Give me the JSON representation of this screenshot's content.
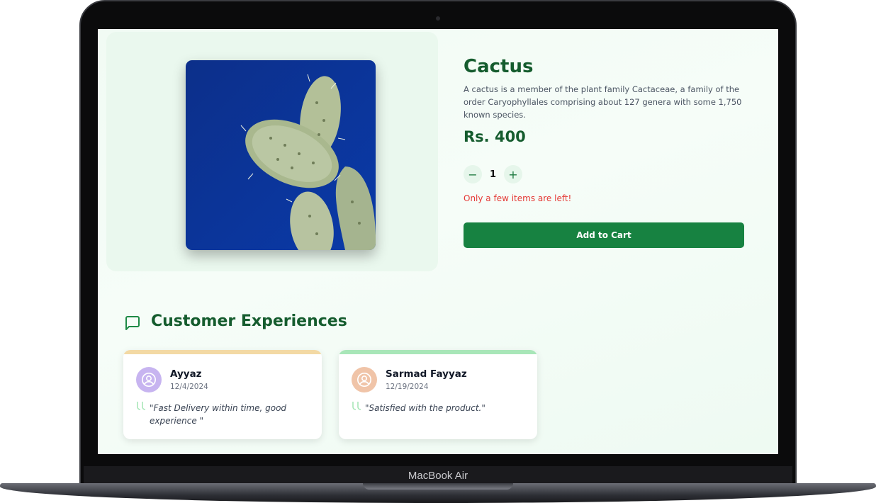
{
  "device": {
    "label": "MacBook Air"
  },
  "product": {
    "name": "Cactus",
    "description": "A cactus is a member of the plant family Cactaceae, a family of the order Caryophyllales comprising about 127 genera with some 1,750 known species.",
    "price": "Rs. 400",
    "quantity": "1",
    "stock_warning": "Only a few items are left!",
    "add_to_cart_label": "Add to Cart"
  },
  "quantity_controls": {
    "decrement_icon": "minus-icon",
    "increment_icon": "plus-icon"
  },
  "reviews_section": {
    "title": "Customer Experiences",
    "icon": "message-square-icon",
    "reviews": [
      {
        "name": "Ayyaz",
        "date": "12/4/2024",
        "text": "\"Fast Delivery within time, good experience \"",
        "accent": "#f3d9a4",
        "avatar_color": "#c7b4f0"
      },
      {
        "name": "Sarmad Fayyaz",
        "date": "12/19/2024",
        "text": "\"Satisfied with the product.\"",
        "accent": "#a8e6b8",
        "avatar_color": "#f0c4a8"
      }
    ]
  },
  "colors": {
    "brand_green": "#178241",
    "heading_green": "#155c2e",
    "warning_red": "#e53935"
  }
}
